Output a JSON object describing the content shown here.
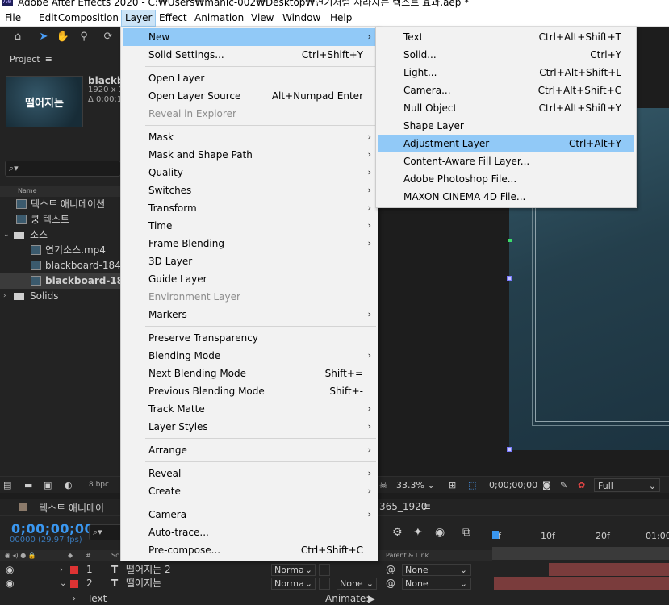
{
  "app": {
    "title": "Adobe After Effects 2020 - C:₩Users₩manic-002₩Desktop₩연기처럼 사라지는 텍스트 효과.aep *",
    "icon_text": "Ae"
  },
  "menubar": {
    "items": [
      "File",
      "Edit",
      "Composition",
      "Layer",
      "Effect",
      "Animation",
      "View",
      "Window",
      "Help"
    ],
    "active": "Layer"
  },
  "toolbar": {
    "icons": [
      "home-icon",
      "selection-arrow-icon",
      "hand-icon",
      "zoom-icon",
      "rotate-icon"
    ]
  },
  "project": {
    "title": "Project",
    "thumb_text": "떨어지는",
    "thumb_name": "blackb",
    "thumb_res": "1920 x 1",
    "thumb_dur": "Δ 0;00;1",
    "search_placeholder": "⌕▾",
    "col_name": "Name",
    "items": [
      {
        "label": "텍스트 애니메이션",
        "type": "comp",
        "indent": 1
      },
      {
        "label": "쿵 텍스트",
        "type": "comp",
        "indent": 1
      },
      {
        "label": "소스",
        "type": "folder",
        "indent": 0,
        "expanded": true
      },
      {
        "label": "연기소스.mp4",
        "type": "footage",
        "indent": 2
      },
      {
        "label": "blackboard-1846",
        "type": "image",
        "indent": 2
      },
      {
        "label": "blackboard-18",
        "type": "comp",
        "indent": 2,
        "selected": true
      },
      {
        "label": "Solids",
        "type": "folder",
        "indent": 0,
        "expanded": false
      }
    ]
  },
  "layer_menu": {
    "items": [
      {
        "label": "New",
        "submenu": true,
        "highlighted": true
      },
      {
        "label": "Solid Settings...",
        "shortcut": "Ctrl+Shift+Y"
      },
      {
        "sep": true
      },
      {
        "label": "Open Layer"
      },
      {
        "label": "Open Layer Source",
        "shortcut": "Alt+Numpad Enter"
      },
      {
        "label": "Reveal in Explorer",
        "disabled": true
      },
      {
        "sep": true
      },
      {
        "label": "Mask",
        "submenu": true
      },
      {
        "label": "Mask and Shape Path",
        "submenu": true
      },
      {
        "label": "Quality",
        "submenu": true
      },
      {
        "label": "Switches",
        "submenu": true
      },
      {
        "label": "Transform",
        "submenu": true
      },
      {
        "label": "Time",
        "submenu": true
      },
      {
        "label": "Frame Blending",
        "submenu": true
      },
      {
        "label": "3D Layer"
      },
      {
        "label": "Guide Layer"
      },
      {
        "label": "Environment Layer",
        "disabled": true
      },
      {
        "label": "Markers",
        "submenu": true
      },
      {
        "sep": true
      },
      {
        "label": "Preserve Transparency"
      },
      {
        "label": "Blending Mode",
        "submenu": true
      },
      {
        "label": "Next Blending Mode",
        "shortcut": "Shift+="
      },
      {
        "label": "Previous Blending Mode",
        "shortcut": "Shift+-"
      },
      {
        "label": "Track Matte",
        "submenu": true
      },
      {
        "label": "Layer Styles",
        "submenu": true
      },
      {
        "sep": true
      },
      {
        "label": "Arrange",
        "submenu": true
      },
      {
        "sep": true
      },
      {
        "label": "Reveal",
        "submenu": true
      },
      {
        "label": "Create",
        "submenu": true
      },
      {
        "sep": true
      },
      {
        "label": "Camera",
        "submenu": true
      },
      {
        "label": "Auto-trace..."
      },
      {
        "label": "Pre-compose...",
        "shortcut": "Ctrl+Shift+C"
      }
    ]
  },
  "new_submenu": {
    "items": [
      {
        "label": "Text",
        "shortcut": "Ctrl+Alt+Shift+T"
      },
      {
        "label": "Solid...",
        "shortcut": "Ctrl+Y"
      },
      {
        "label": "Light...",
        "shortcut": "Ctrl+Alt+Shift+L"
      },
      {
        "label": "Camera...",
        "shortcut": "Ctrl+Alt+Shift+C"
      },
      {
        "label": "Null Object",
        "shortcut": "Ctrl+Alt+Shift+Y"
      },
      {
        "label": "Shape Layer"
      },
      {
        "label": "Adjustment Layer",
        "shortcut": "Ctrl+Alt+Y",
        "highlighted": true
      },
      {
        "label": "Content-Aware Fill Layer..."
      },
      {
        "label": "Adobe Photoshop File..."
      },
      {
        "label": "MAXON CINEMA 4D File..."
      }
    ]
  },
  "viewer_footer": {
    "bpc": "8 bpc",
    "zoom": "33.3%",
    "timecode": "0;00;00;00",
    "resolution": "Full"
  },
  "timeline": {
    "tab_name": "텍스트 애니메이",
    "tab2_name": "365_1920",
    "timecode": "0;00;00;00",
    "frame_info": "00000 (29.97 fps)",
    "search_placeholder": "⌕▾",
    "col_parent": "Parent & Link",
    "col_hash": "#",
    "col_src": "Sc",
    "ruler": [
      "0f",
      "10f",
      "20f",
      "01:00"
    ],
    "layers": [
      {
        "num": "1",
        "type": "T",
        "name": "떨어지는 2",
        "mode": "Norma",
        "trkmat": "",
        "parent": "None"
      },
      {
        "num": "2",
        "type": "T",
        "name": "떨어지는",
        "mode": "Norma",
        "trkmat": "None",
        "parent": "None"
      }
    ],
    "sub_row_label": "Text",
    "animate_label": "Animate:"
  },
  "colors": {
    "accent": "#3a97f0",
    "menu_highlight": "#91c9f7",
    "label_red": "#d33333"
  }
}
